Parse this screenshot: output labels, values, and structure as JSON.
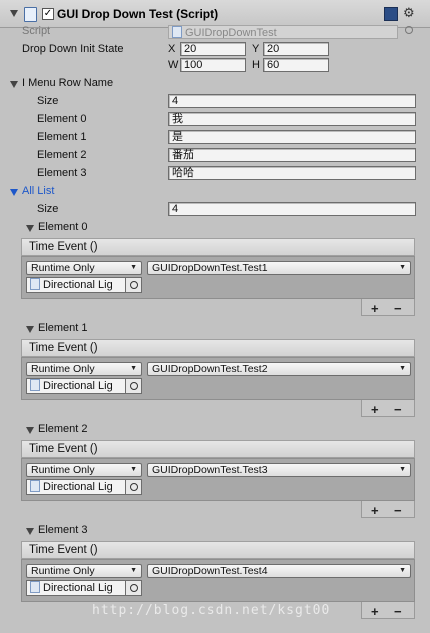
{
  "header": {
    "title": "GUI Drop Down Test (Script)",
    "enabled_check": "✓"
  },
  "script_row": {
    "label": "Script",
    "value": "GUIDropDownTest"
  },
  "init_state": {
    "label": "Drop Down Init State",
    "x_label": "X",
    "x": "20",
    "y_label": "Y",
    "y": "20",
    "w_label": "W",
    "w": "100",
    "h_label": "H",
    "h": "60"
  },
  "menu_row": {
    "label": "I Menu Row Name",
    "size_label": "Size",
    "size": "4",
    "elements": [
      {
        "label": "Element 0",
        "value": "我"
      },
      {
        "label": "Element 1",
        "value": "是"
      },
      {
        "label": "Element 2",
        "value": "番茄"
      },
      {
        "label": "Element 3",
        "value": "哈哈"
      }
    ]
  },
  "all_list": {
    "label": "All List",
    "size_label": "Size",
    "size": "4",
    "elements": [
      {
        "label": "Element 0",
        "event": "Time Event ()",
        "mode": "Runtime Only",
        "function": "GUIDropDownTest.Test1",
        "object": "Directional Lig"
      },
      {
        "label": "Element 1",
        "event": "Time Event ()",
        "mode": "Runtime Only",
        "function": "GUIDropDownTest.Test2",
        "object": "Directional Lig"
      },
      {
        "label": "Element 2",
        "event": "Time Event ()",
        "mode": "Runtime Only",
        "function": "GUIDropDownTest.Test3",
        "object": "Directional Lig"
      },
      {
        "label": "Element 3",
        "event": "Time Event ()",
        "mode": "Runtime Only",
        "function": "GUIDropDownTest.Test4",
        "object": "Directional Lig"
      }
    ]
  },
  "buttons": {
    "plus": "+",
    "minus": "−"
  },
  "watermark": "http://blog.csdn.net/ksgt00",
  "colors": {
    "background": "#c2c2c2",
    "foldout_blue": "#1d57c9"
  }
}
